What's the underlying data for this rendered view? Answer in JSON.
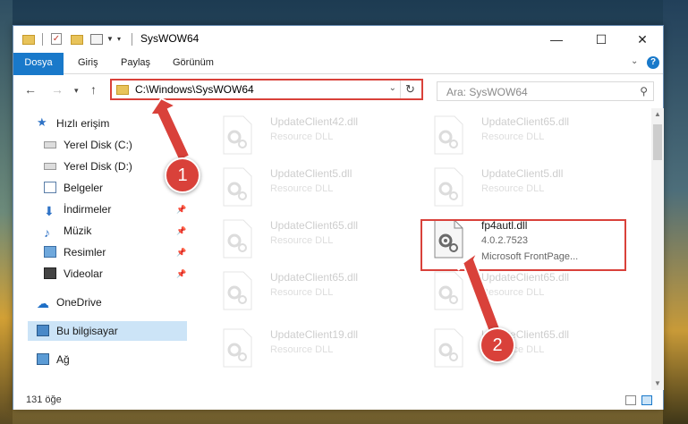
{
  "window": {
    "title": "SysWOW64",
    "controls": {
      "minimize": "—",
      "maximize": "☐",
      "close": "✕"
    }
  },
  "ribbon": {
    "tabs": [
      {
        "label": "Dosya"
      },
      {
        "label": "Giriş"
      },
      {
        "label": "Paylaş"
      },
      {
        "label": "Görünüm"
      }
    ],
    "expand_icon": "chevron-down-icon",
    "help_icon": "help-icon"
  },
  "navigation": {
    "address": "C:\\Windows\\SysWOW64",
    "search_placeholder": "Ara: SysWOW64"
  },
  "sidebar": {
    "items": [
      {
        "label": "Hızlı erişim",
        "icon": "star-icon"
      },
      {
        "label": "Yerel Disk (C:)",
        "icon": "drive-icon"
      },
      {
        "label": "Yerel Disk (D:)",
        "icon": "drive-icon"
      },
      {
        "label": "Belgeler",
        "icon": "documents-icon"
      },
      {
        "label": "İndirmeler",
        "icon": "downloads-icon"
      },
      {
        "label": "Müzik",
        "icon": "music-icon"
      },
      {
        "label": "Resimler",
        "icon": "pictures-icon"
      },
      {
        "label": "Videolar",
        "icon": "videos-icon"
      },
      {
        "label": "OneDrive",
        "icon": "cloud-icon"
      },
      {
        "label": "Bu bilgisayar",
        "icon": "computer-icon"
      },
      {
        "label": "Ağ",
        "icon": "network-icon"
      }
    ]
  },
  "files": {
    "col1": [
      {
        "name": "UpdateClient42.dll",
        "desc": "Resource DLL"
      },
      {
        "name": "UpdateClient5.dll",
        "desc": "Resource DLL"
      },
      {
        "name": "UpdateClient65.dll",
        "desc": "Resource DLL"
      },
      {
        "name": "UpdateClient65.dll",
        "desc": "Resource DLL"
      },
      {
        "name": "UpdateClient19.dll",
        "desc": "Resource DLL"
      }
    ],
    "col2": [
      {
        "name": "UpdateClient65.dll",
        "desc": "Resource DLL"
      },
      {
        "name": "UpdateClient5.dll",
        "desc": "Resource DLL"
      },
      {
        "name": "UpdateClient65.dll",
        "desc": "Resource DLL"
      },
      {
        "name": "UpdateClient65.dll",
        "desc": "Resource DLL"
      }
    ],
    "highlighted": {
      "name": "fp4autl.dll",
      "version": "4.0.2.7523",
      "description": "Microsoft FrontPage..."
    }
  },
  "status": {
    "count": "131 öğe"
  },
  "annotations": {
    "step1": "1",
    "step2": "2",
    "color": "#d9413a"
  }
}
